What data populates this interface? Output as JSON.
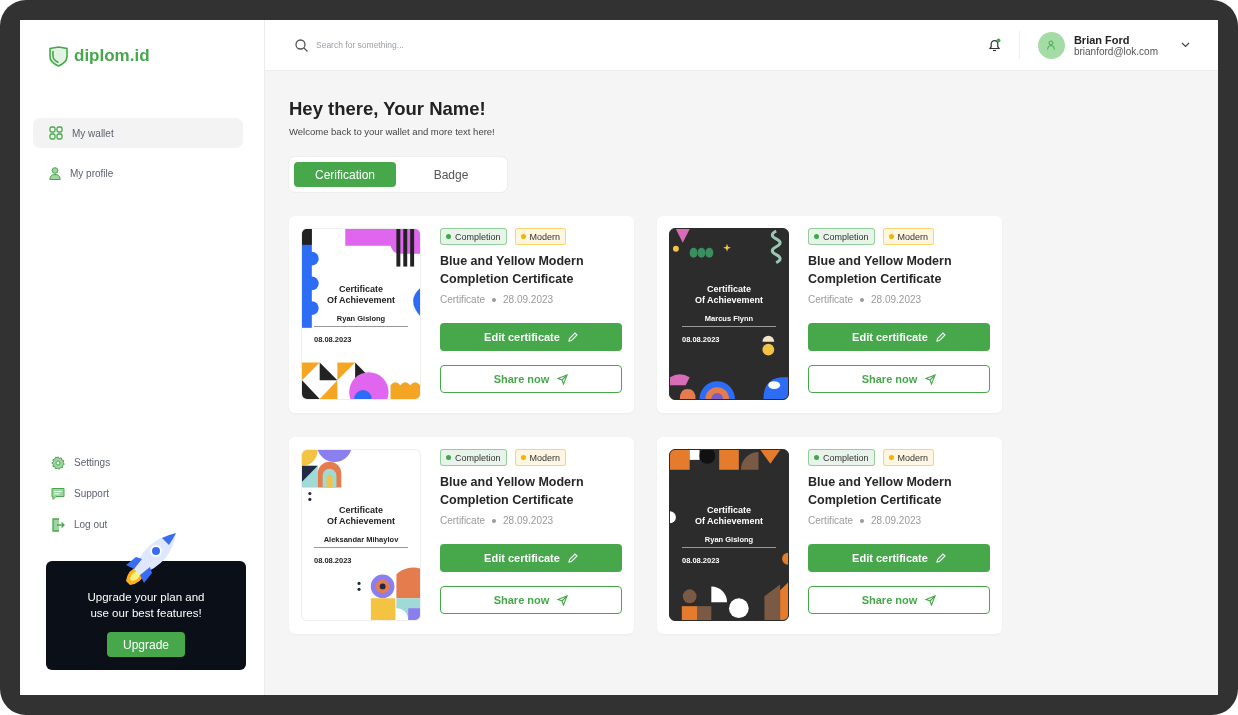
{
  "brand": {
    "name": "diplom.id"
  },
  "sidebar": {
    "items": [
      {
        "label": "My wallet",
        "selected": true
      },
      {
        "label": "My profile",
        "selected": false
      }
    ],
    "footer_items": [
      {
        "label": "Settings"
      },
      {
        "label": "Support"
      },
      {
        "label": "Log out"
      }
    ],
    "upgrade": {
      "text": "Upgrade your plan and use our best features!",
      "button": "Upgrade"
    }
  },
  "topbar": {
    "search": {
      "placeholder": "Search for something..."
    },
    "notification_dot": true,
    "user": {
      "name": "Brian Ford",
      "email": "brianford@lok.com"
    }
  },
  "greeting": {
    "title": "Hey there, Your Name!",
    "subtitle": "Welcome back to your wallet and more text here!"
  },
  "tabs": [
    {
      "label": "Cerification",
      "selected": true
    },
    {
      "label": "Badge",
      "selected": false
    }
  ],
  "certificates": [
    {
      "kind": "waves",
      "preview": {
        "title_lines": [
          "Certificate",
          "Of Achievement"
        ],
        "recipient": "Ryan Gislong",
        "date": "08.08.2023"
      },
      "tags": [
        {
          "label": "Completion",
          "color": "#3ea84a"
        },
        {
          "label": "Modern",
          "color": "#f5b400"
        }
      ],
      "title": "Blue and Yellow Modern Completion Certificate",
      "type": "Certificate",
      "date": "28.09.2023",
      "edit": "Edit certificate",
      "share": "Share now"
    },
    {
      "kind": "doodles",
      "preview": {
        "title_lines": [
          "Certificate",
          "Of Achievement"
        ],
        "recipient": "Marcus Flynn",
        "date": "08.08.2023"
      },
      "tags": [
        {
          "label": "Completion",
          "color": "#3ea84a"
        },
        {
          "label": "Modern",
          "color": "#f5b400"
        }
      ],
      "title": "Blue and Yellow Modern Completion Certificate",
      "type": "Certificate",
      "date": "28.09.2023",
      "edit": "Edit certificate",
      "share": "Share now"
    },
    {
      "kind": "arches",
      "preview": {
        "title_lines": [
          "Certificate",
          "Of Achievement"
        ],
        "recipient": "Aleksandar Mihaylov",
        "date": "08.08.2023"
      },
      "tags": [
        {
          "label": "Completion",
          "color": "#3ea84a"
        },
        {
          "label": "Modern",
          "color": "#f5b400"
        }
      ],
      "title": "Blue and Yellow Modern Completion Certificate",
      "type": "Certificate",
      "date": "28.09.2023",
      "edit": "Edit certificate",
      "share": "Share now"
    },
    {
      "kind": "shapes",
      "preview": {
        "title_lines": [
          "Certificate",
          "Of Achievement"
        ],
        "recipient": "Ryan Gislong",
        "date": "08.08.2023"
      },
      "tags": [
        {
          "label": "Completion",
          "color": "#3ea84a"
        },
        {
          "label": "Modern",
          "color": "#f5b400"
        }
      ],
      "title": "Blue and Yellow Modern Completion Certificate",
      "type": "Certificate",
      "date": "28.09.2023",
      "edit": "Edit certificate",
      "share": "Share now"
    }
  ]
}
